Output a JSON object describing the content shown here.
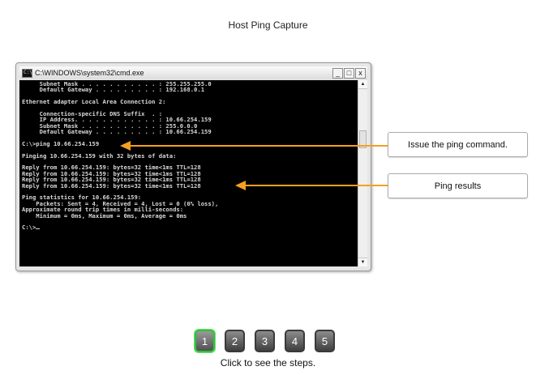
{
  "page_title": "Host Ping Capture",
  "window": {
    "title": "C:\\WINDOWS\\system32\\cmd.exe",
    "buttons": {
      "minimize": "_",
      "maximize": "□",
      "close": "x"
    }
  },
  "console": {
    "lines": [
      "     Subnet Mask . . . . . . . . . . . : 255.255.255.0",
      "     Default Gateway . . . . . . . . . : 192.168.0.1",
      "",
      "Ethernet adapter Local Area Connection 2:",
      "",
      "     Connection-specific DNS Suffix  . :",
      "     IP Address. . . . . . . . . . . . : 10.66.254.159",
      "     Subnet Mask . . . . . . . . . . . : 255.0.0.0",
      "     Default Gateway . . . . . . . . . : 10.66.254.159",
      "",
      "C:\\>ping 10.66.254.159",
      "",
      "Pinging 10.66.254.159 with 32 bytes of data:",
      "",
      "Reply from 10.66.254.159: bytes=32 time<1ms TTL=128",
      "Reply from 10.66.254.159: bytes=32 time<1ms TTL=128",
      "Reply from 10.66.254.159: bytes=32 time<1ms TTL=128",
      "Reply from 10.66.254.159: bytes=32 time<1ms TTL=128",
      "",
      "Ping statistics for 10.66.254.159:",
      "    Packets: Sent = 4, Received = 4, Lost = 0 (0% loss),",
      "Approximate round trip times in milli-seconds:",
      "    Minimum = 0ms, Maximum = 0ms, Average = 0ms",
      "",
      "C:\\>"
    ]
  },
  "callouts": {
    "issue": "Issue the ping command.",
    "results": "Ping results"
  },
  "colors": {
    "arrow": "#f5a020",
    "active_step_border": "#2fc23a",
    "console_bg": "#000000",
    "console_text": "#d8d8d8"
  },
  "steps": {
    "buttons": [
      "1",
      "2",
      "3",
      "4",
      "5"
    ],
    "active_index": 0,
    "caption": "Click to see the steps."
  }
}
